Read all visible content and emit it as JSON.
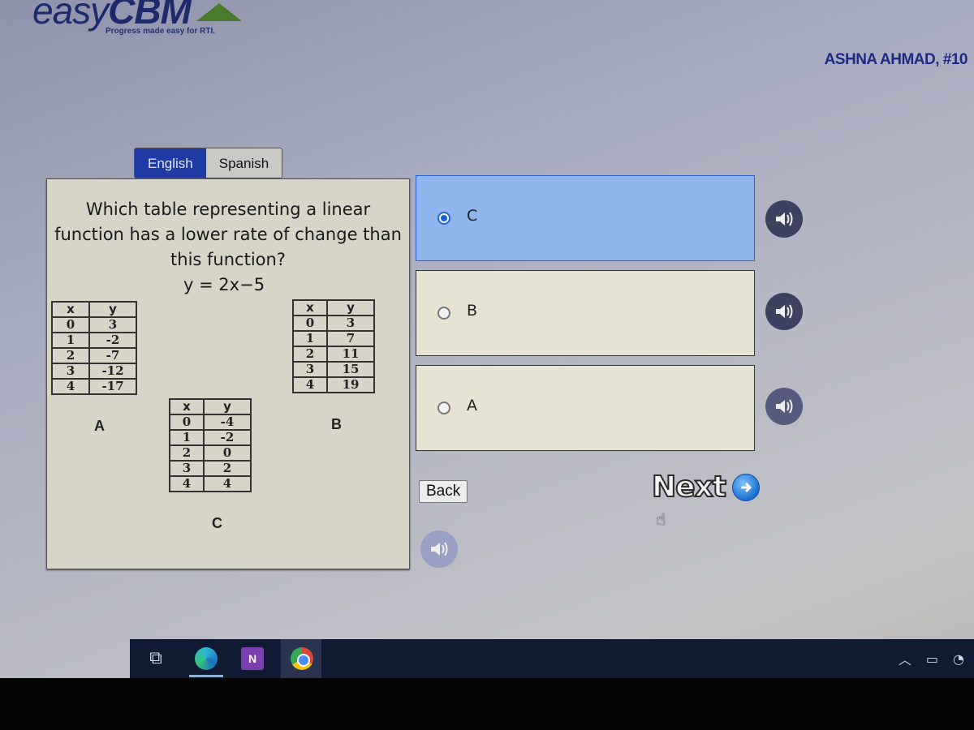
{
  "app": {
    "logo": "easyCBM",
    "logo_prefix": "easy",
    "logo_suffix": "CBM",
    "tagline": "Progress made easy for RTI.",
    "student": "ASHNA AHMAD, #10"
  },
  "language_tabs": [
    {
      "label": "English",
      "active": true
    },
    {
      "label": "Spanish",
      "active": false
    }
  ],
  "question": {
    "text": "Which table representing a linear function has a lower rate of change than this function?",
    "equation": "y = 2x−5",
    "tables": [
      {
        "label": "A",
        "headers": [
          "x",
          "y"
        ],
        "rows": [
          [
            "0",
            "3"
          ],
          [
            "1",
            "-2"
          ],
          [
            "2",
            "-7"
          ],
          [
            "3",
            "-12"
          ],
          [
            "4",
            "-17"
          ]
        ]
      },
      {
        "label": "B",
        "headers": [
          "x",
          "y"
        ],
        "rows": [
          [
            "0",
            "3"
          ],
          [
            "1",
            "7"
          ],
          [
            "2",
            "11"
          ],
          [
            "3",
            "15"
          ],
          [
            "4",
            "19"
          ]
        ]
      },
      {
        "label": "C",
        "headers": [
          "x",
          "y"
        ],
        "rows": [
          [
            "0",
            "-4"
          ],
          [
            "1",
            "-2"
          ],
          [
            "2",
            "0"
          ],
          [
            "3",
            "2"
          ],
          [
            "4",
            "4"
          ]
        ]
      }
    ]
  },
  "options": [
    {
      "label": "C",
      "selected": true
    },
    {
      "label": "B",
      "selected": false
    },
    {
      "label": "A",
      "selected": false
    }
  ],
  "nav": {
    "back_label": "Back",
    "next_label": "Next"
  },
  "icons": {
    "speaker": "speaker-icon",
    "next_arrow": "arrow-right-circle-icon",
    "cursor": "hand-pointer-icon"
  },
  "colors": {
    "selected_option": "#8fb4ee",
    "unselected_option": "#e6e3d2",
    "active_tab": "#1f3aa5",
    "student_name": "#1c2a85",
    "taskbar": "#111a33"
  },
  "taskbar": {
    "apps": [
      "task-view",
      "edge",
      "onenote",
      "chrome"
    ],
    "onenote_letter": "N",
    "tray": [
      "chevron-up",
      "battery",
      "wifi"
    ]
  }
}
